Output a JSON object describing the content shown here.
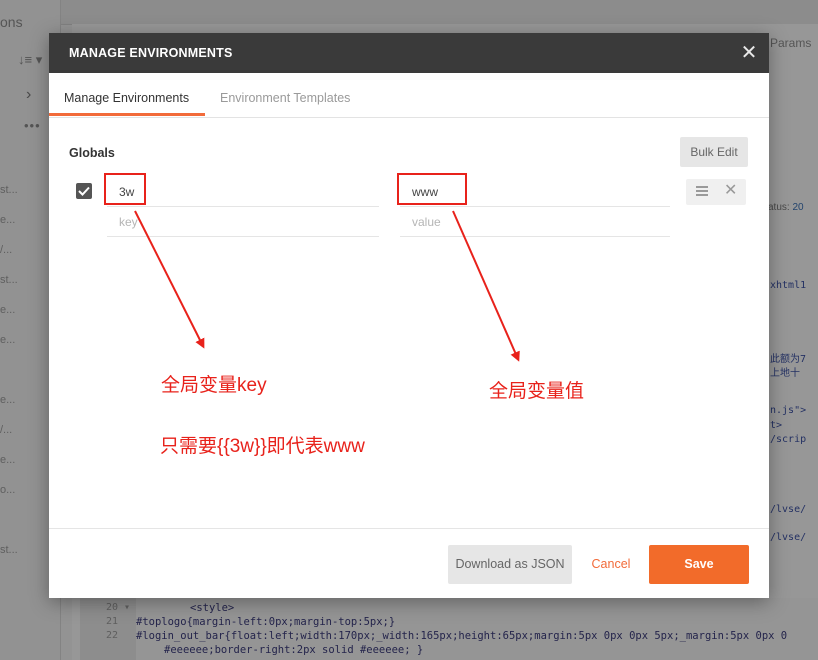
{
  "background": {
    "sidebar_tab": "ons",
    "sort_icon": "sort-icon",
    "row_snippets": [
      "st...",
      "e...",
      "/...",
      "st...",
      "e...",
      "e...",
      "e...",
      "/...",
      "e...",
      "o...",
      "st..."
    ],
    "params_label": "Params",
    "status_label": "atus:",
    "status_value": "20",
    "code_right": [
      "xhtml1",
      "此额为7",
      "上地十",
      "n.js\">",
      "t>",
      "/scrip",
      "/lvse/",
      "/lvse/"
    ],
    "gutter": [
      "20 ▾",
      "21",
      "22"
    ],
    "code_bottom": [
      "<style>",
      "#toplogo{margin-left:0px;margin-top:5px;}",
      "#login_out_bar{float:left;width:170px;_width:165px;height:65px;margin:5px 0px 0px 5px;_margin:5px 0px 0",
      "#eeeeee;border-right:2px solid #eeeeee; }"
    ]
  },
  "modal": {
    "title": "MANAGE ENVIRONMENTS",
    "close_icon": "close-icon",
    "tabs": [
      {
        "label": "Manage Environments",
        "active": true
      },
      {
        "label": "Environment Templates",
        "active": false
      }
    ],
    "section_title": "Globals",
    "bulk_edit_label": "Bulk Edit",
    "rows": [
      {
        "checked": true,
        "key": "3w",
        "value": "www"
      },
      {
        "key_placeholder": "key",
        "value_placeholder": "value"
      }
    ],
    "annotations": {
      "key_note": "全局变量key",
      "value_note": "全局变量值",
      "usage_note": "只需要{{3w}}即代表www",
      "color": "#e8221b"
    },
    "footer": {
      "download_label": "Download as JSON",
      "cancel_label": "Cancel",
      "save_label": "Save"
    },
    "accent_color": "#f26b3a"
  }
}
